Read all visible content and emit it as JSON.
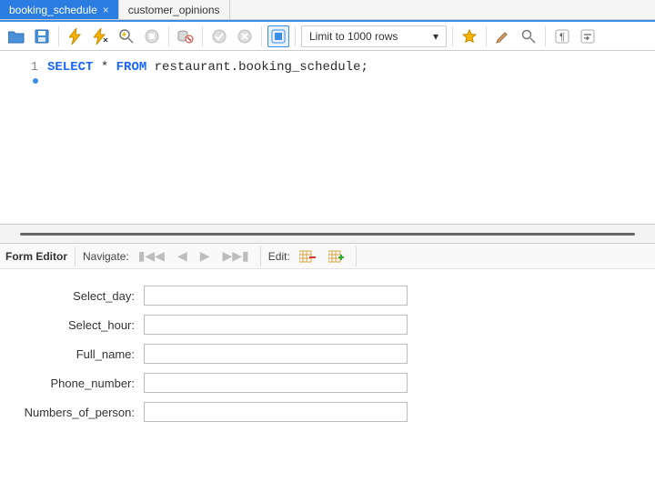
{
  "tabs": [
    {
      "label": "booking_schedule",
      "active": true,
      "closable": true
    },
    {
      "label": "customer_opinions",
      "active": false,
      "closable": false
    }
  ],
  "toolbar": {
    "limit_label": "Limit to 1000 rows"
  },
  "editor": {
    "line_no": "1",
    "kw_select": "SELECT",
    "star": " * ",
    "kw_from": "FROM",
    "ref": " restaurant.booking_schedule;"
  },
  "form_panel": {
    "title": "Form Editor",
    "navigate_label": "Navigate:",
    "edit_label": "Edit:",
    "fields": [
      {
        "label": "Select_day:",
        "value": ""
      },
      {
        "label": "Select_hour:",
        "value": ""
      },
      {
        "label": "Full_name:",
        "value": ""
      },
      {
        "label": "Phone_number:",
        "value": ""
      },
      {
        "label": "Numbers_of_person:",
        "value": ""
      }
    ]
  }
}
